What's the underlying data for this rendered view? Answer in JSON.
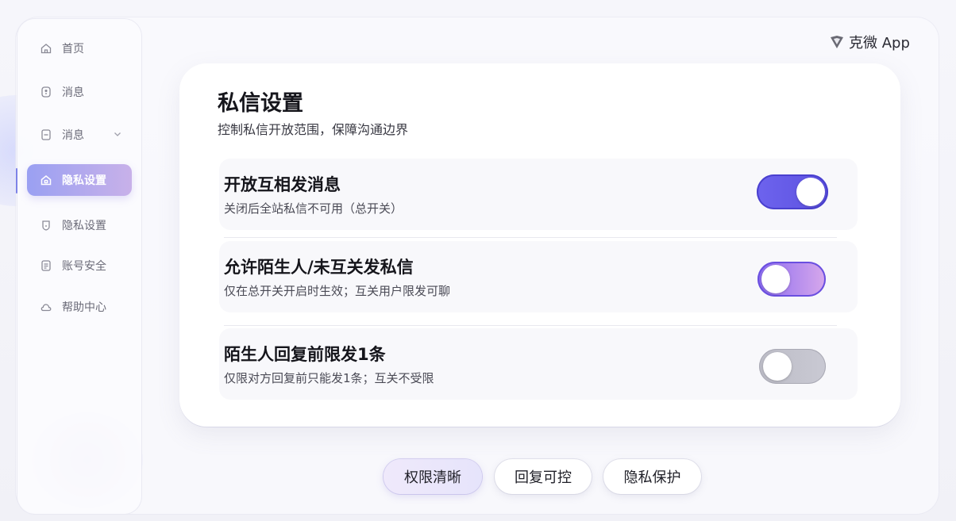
{
  "brand": {
    "name": "克微 App"
  },
  "sidebar": {
    "items": [
      {
        "label": "首页",
        "icon": "home-icon"
      },
      {
        "label": "消息",
        "icon": "message-icon"
      },
      {
        "label": "消息",
        "icon": "document-icon",
        "expandable": true
      },
      {
        "label": "隐私设置",
        "icon": "home-lock-icon",
        "active": true
      },
      {
        "label": "隐私设置",
        "icon": "shield-icon"
      },
      {
        "label": "账号安全",
        "icon": "list-icon"
      },
      {
        "label": "帮助中心",
        "icon": "cloud-icon"
      }
    ]
  },
  "card": {
    "title": "私信设置",
    "subtitle": "控制私信开放范围，保障沟通边界",
    "settings": [
      {
        "title": "开放互相发消息",
        "description": "关闭后全站私信不可用（总开关）",
        "state": "on"
      },
      {
        "title": "允许陌生人/未互关发私信",
        "description": "仅在总开关开启时生效；互关用户限发可聊",
        "state": "off"
      },
      {
        "title": "陌生人回复前限发1条",
        "description": "仅限对方回复前只能发1条；互关不受限",
        "state": "off"
      }
    ]
  },
  "bottom_tabs": [
    {
      "label": "权限清晰",
      "selected": true
    },
    {
      "label": "回复可控",
      "selected": false
    },
    {
      "label": "隐私保护",
      "selected": false
    }
  ],
  "colors": {
    "accent": "#5d52df",
    "active_nav_start": "#9aa0f2",
    "active_nav_end": "#c8b1e9"
  }
}
